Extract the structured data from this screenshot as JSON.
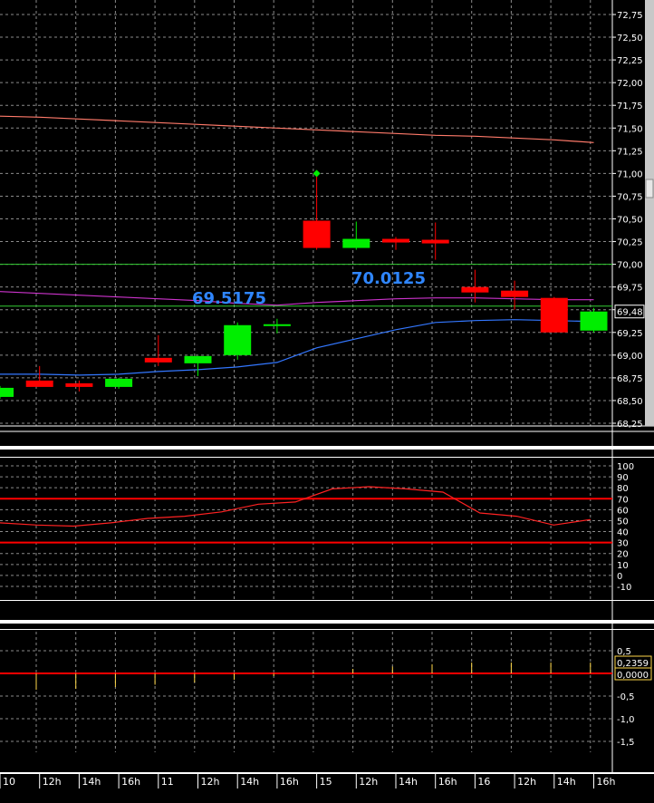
{
  "colors": {
    "background": "#000000",
    "grid": "#8a8a8a",
    "up": "#00ee00",
    "down": "#ff0000",
    "ma_slow": "#ff7a6a",
    "ma_mid": "#cc33cc",
    "ma_fast": "#3377ff",
    "hline": "#33cc33",
    "annotation": "#2f86ff",
    "rsi_line": "#ff2222",
    "rsi_levels": "#ff0000",
    "hist": "#ffd84a",
    "zero_line": "#ff0000",
    "panel_border": "#ffffff",
    "arrow": "#00ee00"
  },
  "x_axis_labels": [
    "10",
    "12h",
    "14h",
    "16h",
    "11",
    "12h",
    "14h",
    "16h",
    "15",
    "12h",
    "14h",
    "16h",
    "16",
    "12h",
    "14h",
    "16h"
  ],
  "chart_data": [
    {
      "type": "candlestick",
      "ylim": [
        68.25,
        72.75
      ],
      "y_ticks": [
        "72,75",
        "72,50",
        "72,25",
        "72,00",
        "71,75",
        "71,50",
        "71,25",
        "71,00",
        "70,75",
        "70,50",
        "70,25",
        "70,00",
        "69,75",
        "69,50",
        "69,25",
        "69,00",
        "68,75",
        "68,50",
        "68,25"
      ],
      "price_tag": "69,48",
      "candles": [
        {
          "o": 68.54,
          "h": 68.66,
          "l": 68.52,
          "c": 68.64
        },
        {
          "o": 68.72,
          "h": 68.88,
          "l": 68.68,
          "c": 68.65
        },
        {
          "o": 68.69,
          "h": 68.72,
          "l": 68.6,
          "c": 68.65
        },
        {
          "o": 68.65,
          "h": 68.75,
          "l": 68.63,
          "c": 68.74
        },
        {
          "o": 68.97,
          "h": 69.22,
          "l": 68.88,
          "c": 68.92
        },
        {
          "o": 68.91,
          "h": 68.99,
          "l": 68.77,
          "c": 68.99
        },
        {
          "o": 69.0,
          "h": 69.36,
          "l": 68.95,
          "c": 69.33
        },
        {
          "o": 69.34,
          "h": 69.4,
          "l": 69.24,
          "c": 69.34
        },
        {
          "o": 70.48,
          "h": 71.0,
          "l": 70.16,
          "c": 70.18
        },
        {
          "o": 70.18,
          "h": 70.47,
          "l": 70.16,
          "c": 70.28
        },
        {
          "o": 70.28,
          "h": 70.3,
          "l": 70.16,
          "c": 70.24
        },
        {
          "o": 70.27,
          "h": 70.46,
          "l": 70.05,
          "c": 70.23
        },
        {
          "o": 69.75,
          "h": 69.94,
          "l": 69.58,
          "c": 69.69
        },
        {
          "o": 69.71,
          "h": 69.82,
          "l": 69.5,
          "c": 69.64
        },
        {
          "o": 69.63,
          "h": 69.64,
          "l": 69.25,
          "c": 69.25
        },
        {
          "o": 69.27,
          "h": 69.52,
          "l": 69.25,
          "c": 69.48
        }
      ],
      "ma_slow": [
        71.63,
        71.62,
        71.6,
        71.58,
        71.56,
        71.54,
        71.52,
        71.5,
        71.48,
        71.46,
        71.44,
        71.42,
        71.41,
        71.39,
        71.37,
        71.34
      ],
      "ma_mid": [
        69.7,
        69.68,
        69.66,
        69.64,
        69.62,
        69.6,
        69.57,
        69.55,
        69.58,
        69.6,
        69.62,
        69.63,
        69.63,
        69.62,
        69.61,
        69.61
      ],
      "ma_fast": [
        68.79,
        68.79,
        68.78,
        68.79,
        68.82,
        68.84,
        68.87,
        68.92,
        69.08,
        69.18,
        69.28,
        69.36,
        69.38,
        69.39,
        69.38,
        69.37
      ],
      "hlines": [
        70.0,
        69.54
      ],
      "annotations": [
        "69.5175",
        "70.0125"
      ],
      "arrow_candle": 8
    },
    {
      "type": "line",
      "ylim": [
        -10,
        100
      ],
      "y_ticks": [
        "100",
        "90",
        "80",
        "70",
        "60",
        "50",
        "40",
        "30",
        "20",
        "10",
        "0",
        "-10"
      ],
      "levels": [
        70,
        30
      ],
      "values": [
        48,
        46,
        45,
        48,
        52,
        54,
        58,
        65,
        67,
        79,
        81,
        79,
        76,
        57,
        54,
        46,
        51
      ]
    },
    {
      "type": "bar",
      "ylim": [
        -1.7,
        0.6
      ],
      "y_ticks": [
        "0,5",
        "0",
        "-0,5",
        "-1,0",
        "-1,5"
      ],
      "value_tags": [
        "0,2359",
        "0,0000"
      ],
      "values": [
        -0.36,
        -0.34,
        -0.3,
        -0.25,
        -0.2,
        -0.14,
        -0.06,
        0.03,
        0.1,
        0.15,
        0.2,
        0.24,
        0.24,
        0.24,
        0.24,
        0.24
      ]
    }
  ]
}
